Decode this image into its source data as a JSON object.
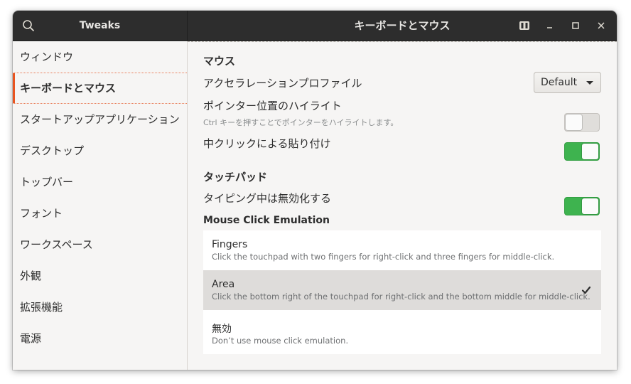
{
  "header": {
    "app_title": "Tweaks",
    "page_title": "キーボードとマウス",
    "icons": [
      "search-icon",
      "keyboard-icon",
      "minimize-icon",
      "maximize-icon",
      "close-icon"
    ]
  },
  "sidebar": {
    "items": [
      {
        "label": "ウィンドウ"
      },
      {
        "label": "キーボードとマウス",
        "active": true
      },
      {
        "label": "スタートアップアプリケーション"
      },
      {
        "label": "デスクトップ"
      },
      {
        "label": "トップバー"
      },
      {
        "label": "フォント"
      },
      {
        "label": "ワークスペース"
      },
      {
        "label": "外観"
      },
      {
        "label": "拡張機能"
      },
      {
        "label": "電源"
      }
    ]
  },
  "mouse": {
    "section_title": "マウス",
    "accel_profile_label": "アクセラレーションプロファイル",
    "accel_profile_value": "Default",
    "pointer_highlight_label": "ポインター位置のハイライト",
    "pointer_highlight_desc": "Ctrl キーを押すことでポインターをハイライトします。",
    "pointer_highlight_on": false,
    "middle_click_paste_label": "中クリックによる貼り付け",
    "middle_click_paste_on": true
  },
  "touchpad": {
    "section_title": "タッチパッド",
    "disable_while_typing_label": "タイピング中は無効化する",
    "disable_while_typing_on": true
  },
  "emulation": {
    "section_title": "Mouse Click Emulation",
    "options": [
      {
        "title": "Fingers",
        "desc": "Click the touchpad with two fingers for right-click and three fingers for middle-click.",
        "selected": false
      },
      {
        "title": "Area",
        "desc": "Click the bottom right of the touchpad for right-click and the bottom middle for middle-click.",
        "selected": true
      },
      {
        "title": "無効",
        "desc": "Don’t use mouse click emulation.",
        "selected": false
      }
    ]
  },
  "colors": {
    "accent": "#e95420",
    "switch_on": "#3eb34f",
    "headerbar": "#2d2d2d"
  }
}
